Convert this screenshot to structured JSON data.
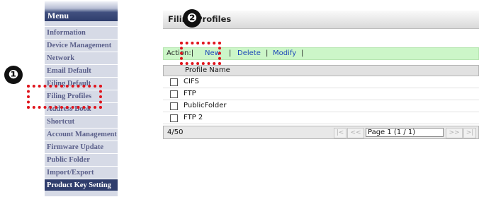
{
  "menu": {
    "title": "Menu",
    "items": [
      "Information",
      "Device Management",
      "Network",
      "Email Default",
      "Filing Default",
      "Filing Profiles",
      "Address Book",
      "Shortcut",
      "Account Management",
      "Firmware Update",
      "Public Folder",
      "Import/Export",
      "Product Key Setting"
    ]
  },
  "annotations": {
    "badge1": "❶",
    "badge2": "❷",
    "accent_color": "#e0141c"
  },
  "panel": {
    "title": "Filing Profiles"
  },
  "action_bar": {
    "label": "Action:|",
    "sep": "|",
    "new": "New",
    "delete": "Delete",
    "modify": "Modify"
  },
  "grid": {
    "column_header": "Profile Name",
    "rows": [
      "CIFS",
      "FTP",
      "PublicFolder",
      "FTP 2"
    ]
  },
  "footer": {
    "count": "4/50",
    "first": "|<",
    "prev": "<<",
    "page": "Page 1 (1 / 1)",
    "next": ">>",
    "last": ">|"
  }
}
